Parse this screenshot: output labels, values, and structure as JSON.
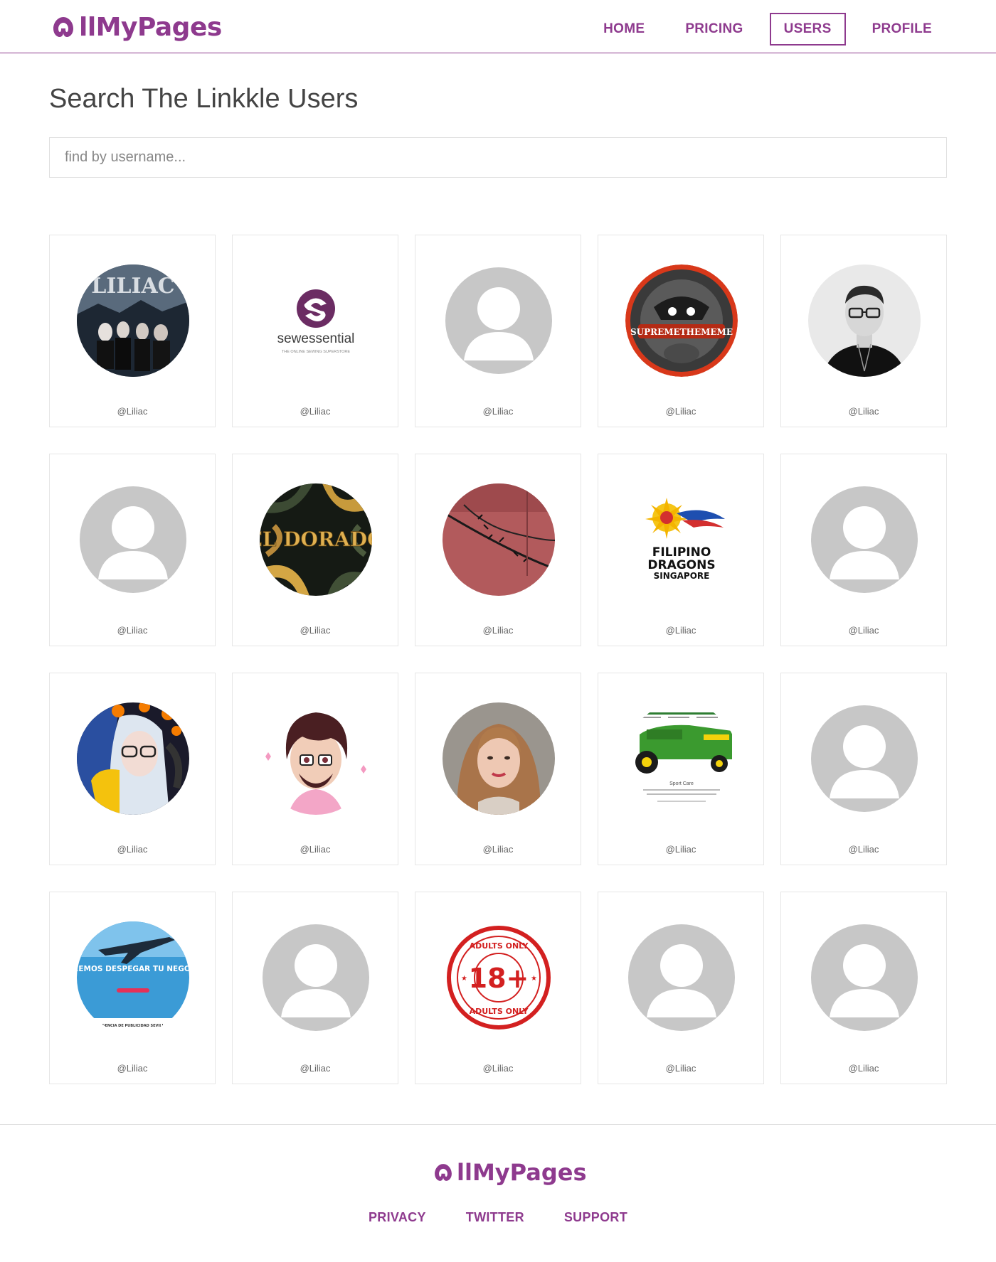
{
  "brand": {
    "name": "AllMyPages",
    "name_rest": "llMyPages",
    "accent": "#8e3a8e"
  },
  "nav": [
    {
      "label": "HOME",
      "active": false
    },
    {
      "label": "PRICING",
      "active": false
    },
    {
      "label": "USERS",
      "active": true
    },
    {
      "label": "PROFILE",
      "active": false
    }
  ],
  "page": {
    "title": "Search The Linkkle Users"
  },
  "search": {
    "placeholder": "find by username...",
    "value": ""
  },
  "users": [
    {
      "username": "@Liliac",
      "avatar": "band-liliac",
      "avatar_text": "LILIAC"
    },
    {
      "username": "@Liliac",
      "avatar": "sewessential-logo",
      "avatar_text": "sewessential",
      "avatar_subtext": "THE ONLINE SEWING SUPERSTORE"
    },
    {
      "username": "@Liliac",
      "avatar": "default-person"
    },
    {
      "username": "@Liliac",
      "avatar": "supremethememe-logo",
      "avatar_text": "SUPREMETHEMEME"
    },
    {
      "username": "@Liliac",
      "avatar": "man-photo"
    },
    {
      "username": "@Liliac",
      "avatar": "default-person"
    },
    {
      "username": "@Liliac",
      "avatar": "el-dorado-logo",
      "avatar_text": "EL DORADO"
    },
    {
      "username": "@Liliac",
      "avatar": "barbed-wire-photo"
    },
    {
      "username": "@Liliac",
      "avatar": "filipino-dragons-logo",
      "avatar_text": "FILIPINO",
      "avatar_text2": "DRAGONS",
      "avatar_text3": "SINGAPORE"
    },
    {
      "username": "@Liliac",
      "avatar": "default-person"
    },
    {
      "username": "@Liliac",
      "avatar": "halloween-gamer-photo"
    },
    {
      "username": "@Liliac",
      "avatar": "cartoon-man"
    },
    {
      "username": "@Liliac",
      "avatar": "woman-photo"
    },
    {
      "username": "@Liliac",
      "avatar": "lawn-mower-site",
      "avatar_text": "Sport Care"
    },
    {
      "username": "@Liliac",
      "avatar": "default-person"
    },
    {
      "username": "@Liliac",
      "avatar": "airplane-ad",
      "avatar_text": "HACEMOS DESPEGAR TU NEGOCIO",
      "avatar_subtext": "AGENCIA DE PUBLICIDAD SEVILLA"
    },
    {
      "username": "@Liliac",
      "avatar": "default-person"
    },
    {
      "username": "@Liliac",
      "avatar": "adults-only-stamp",
      "avatar_text": "18+",
      "avatar_subtext": "ADULTS ONLY"
    },
    {
      "username": "@Liliac",
      "avatar": "default-person"
    },
    {
      "username": "@Liliac",
      "avatar": "default-person"
    }
  ],
  "footer": {
    "brand_rest": "llMyPages",
    "links": [
      "PRIVACY",
      "TWITTER",
      "SUPPORT"
    ]
  }
}
